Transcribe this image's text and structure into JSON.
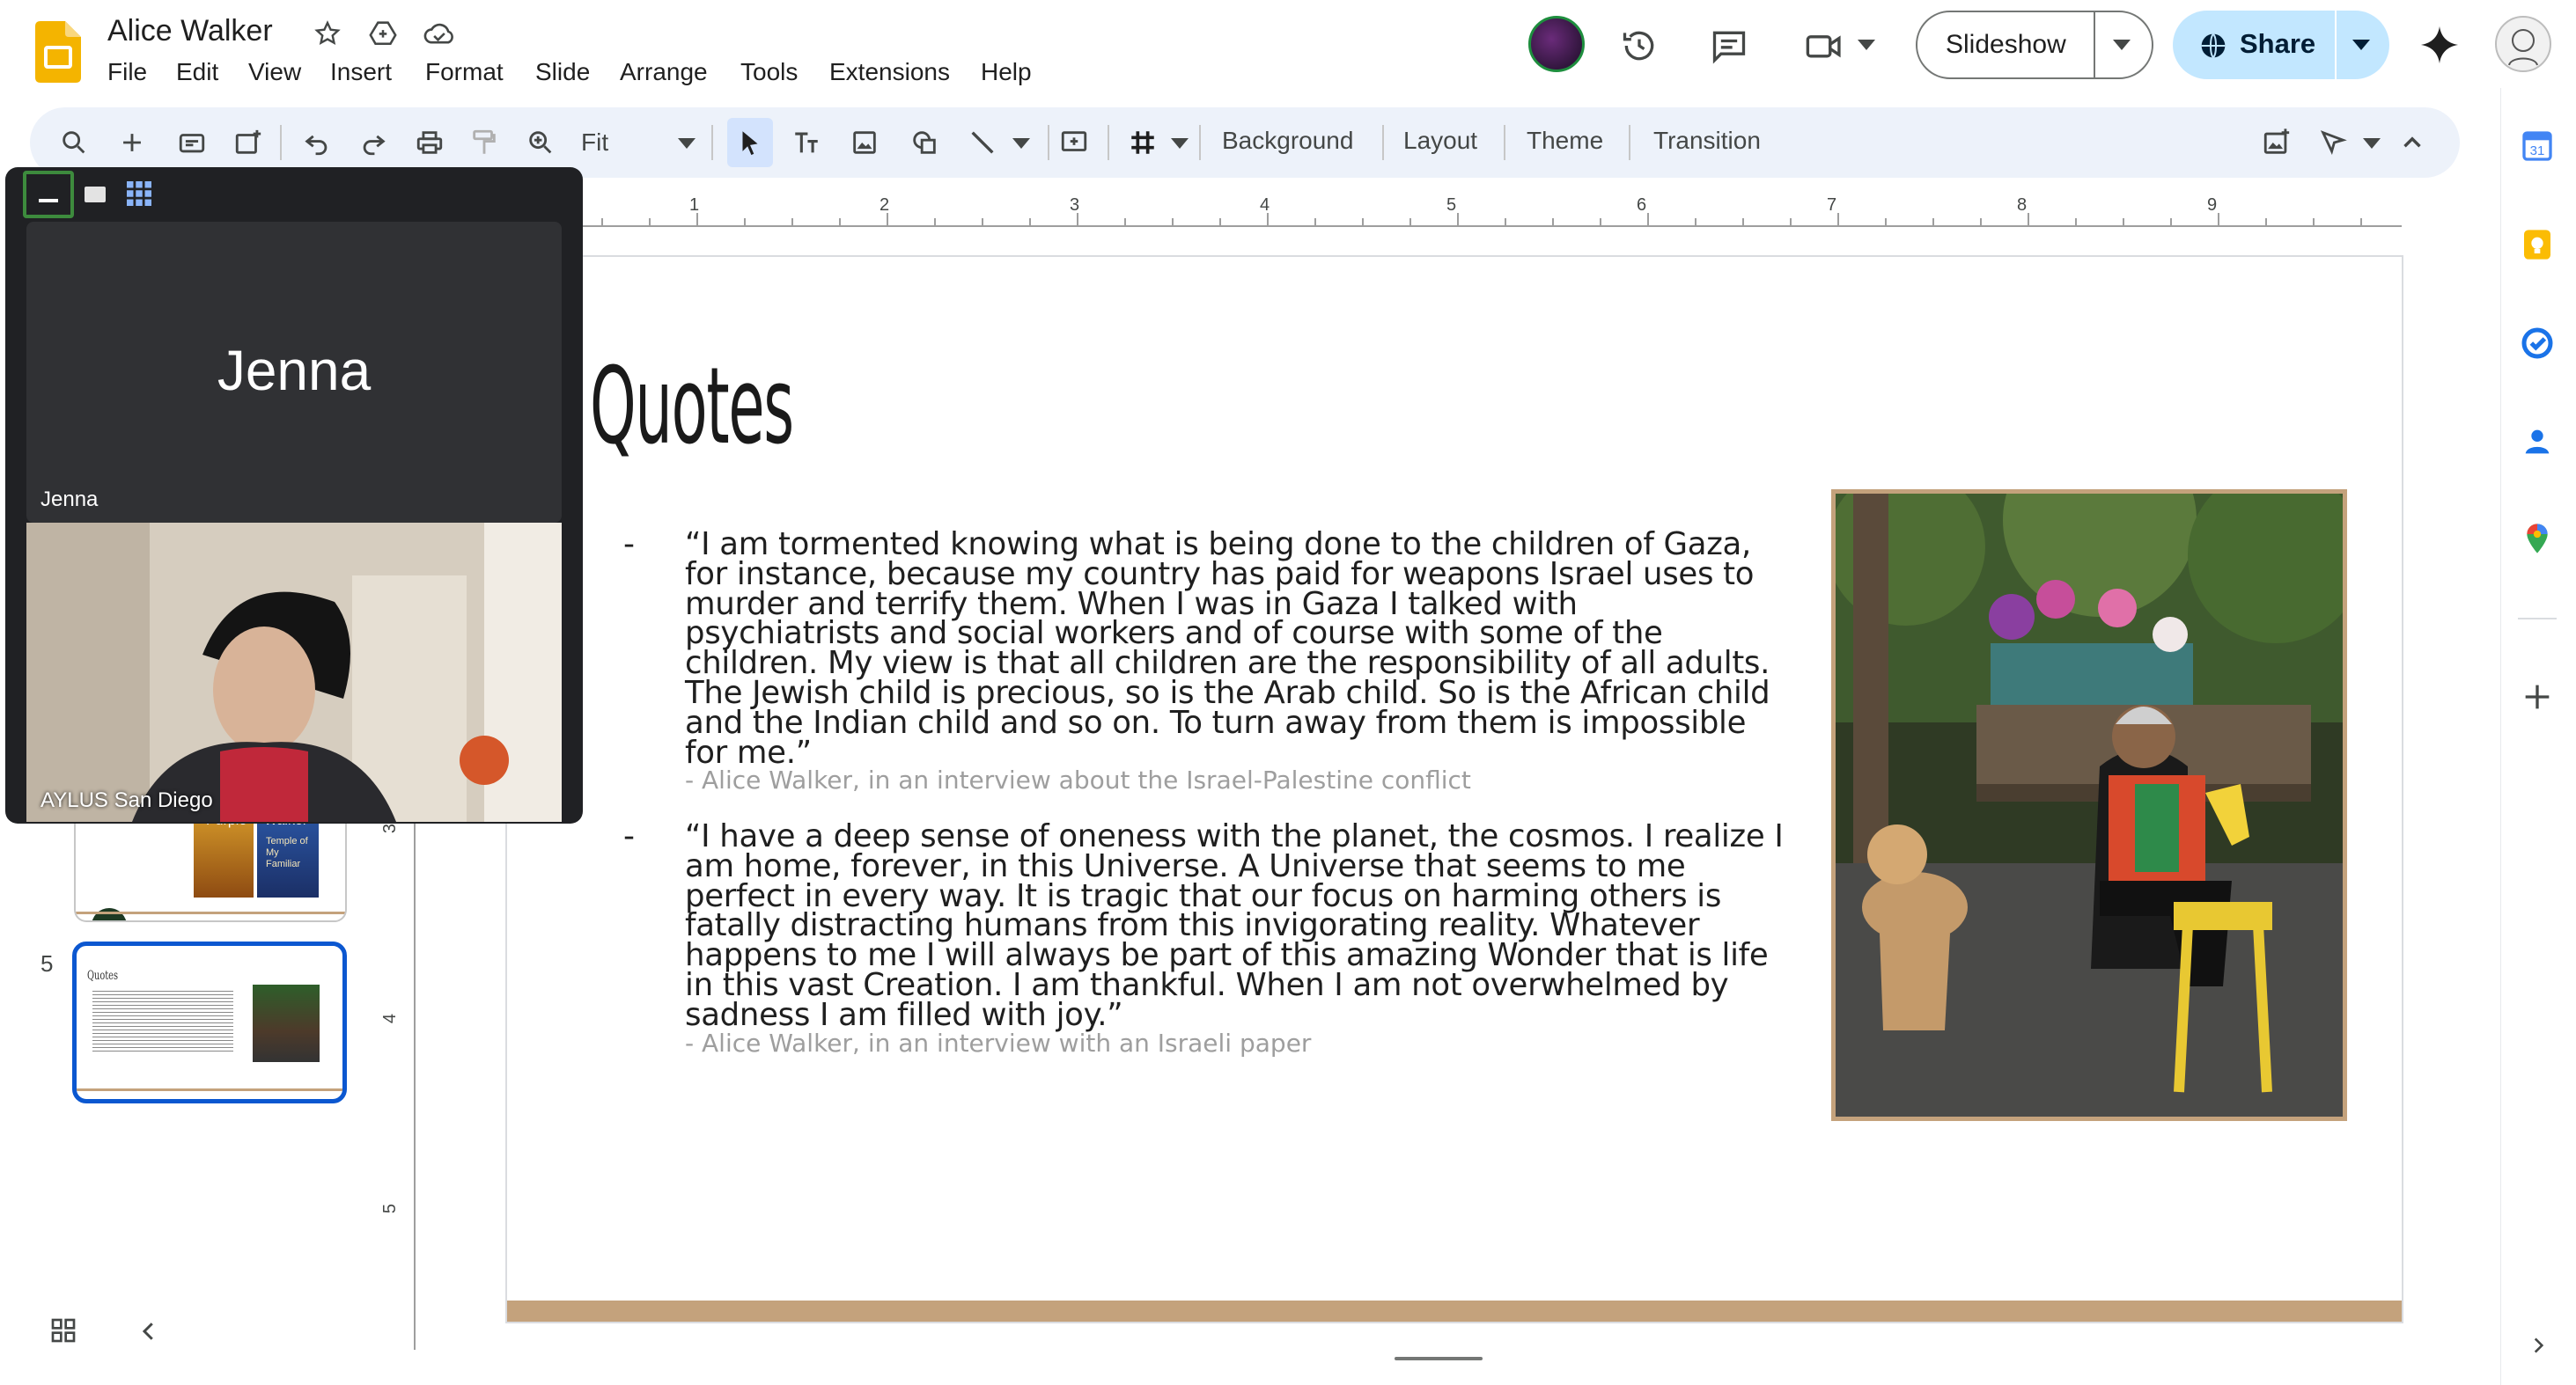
{
  "app": {
    "doc_title": "Alice Walker",
    "menu": [
      "File",
      "Edit",
      "View",
      "Insert",
      "Format",
      "Slide",
      "Arrange",
      "Tools",
      "Extensions",
      "Help"
    ],
    "slideshow_label": "Slideshow",
    "share_label": "Share"
  },
  "toolbar": {
    "zoom_value": "Fit",
    "background_label": "Background",
    "layout_label": "Layout",
    "theme_label": "Theme",
    "transition_label": "Transition"
  },
  "ruler": {
    "h_ticks": [
      "1",
      "2",
      "3",
      "4",
      "5",
      "6",
      "7",
      "8",
      "9"
    ],
    "v_ticks": [
      "3",
      "4",
      "5"
    ]
  },
  "filmstrip": {
    "slide_number": "5",
    "thumb_title": "Quotes",
    "partial_thumb_text": [
      "Purple",
      "Walker",
      "Temple of My Familiar"
    ]
  },
  "meet": {
    "tile1_big_name": "Jenna",
    "tile1_label": "Jenna",
    "tile2_label": "AYLUS San Diego"
  },
  "slide": {
    "title": "Quotes",
    "bullet_char": "-",
    "quote1_lines": [
      "“I am tormented knowing what is being done to the children of Gaza,",
      "for instance, because my country has paid for weapons Israel uses to",
      "murder and terrify them.  When I was in Gaza I talked with",
      "psychiatrists and social workers and of course with some of the",
      "children.  My view is that all children are the responsibility of all adults.",
      "The Jewish child is precious, so is the Arab child.  So is the African child",
      "and the Indian child and so on.  To turn away from them is impossible",
      "for me.”"
    ],
    "quote1_attribution": "- Alice Walker, in an interview about the Israel-Palestine conflict",
    "quote2_lines": [
      "“I have a deep sense of oneness with the planet, the cosmos.  I realize I",
      "am home, forever, in this Universe. A Universe that seems to me",
      "perfect in every way. It is tragic that our focus on harming others is",
      "fatally distracting humans from this invigorating reality. Whatever",
      "happens to me I will always be part of this amazing Wonder that is life",
      "in this vast Creation. I am thankful.  When I am not overwhelmed by",
      "sadness I am filled with joy.”"
    ],
    "quote2_attribution": "- Alice Walker, in an interview with an Israeli paper"
  },
  "colors": {
    "accent_blue": "#0b57d0",
    "share_bg": "#c2e7ff",
    "slide_bar": "#c4a27c",
    "meet_bg": "#202124"
  }
}
